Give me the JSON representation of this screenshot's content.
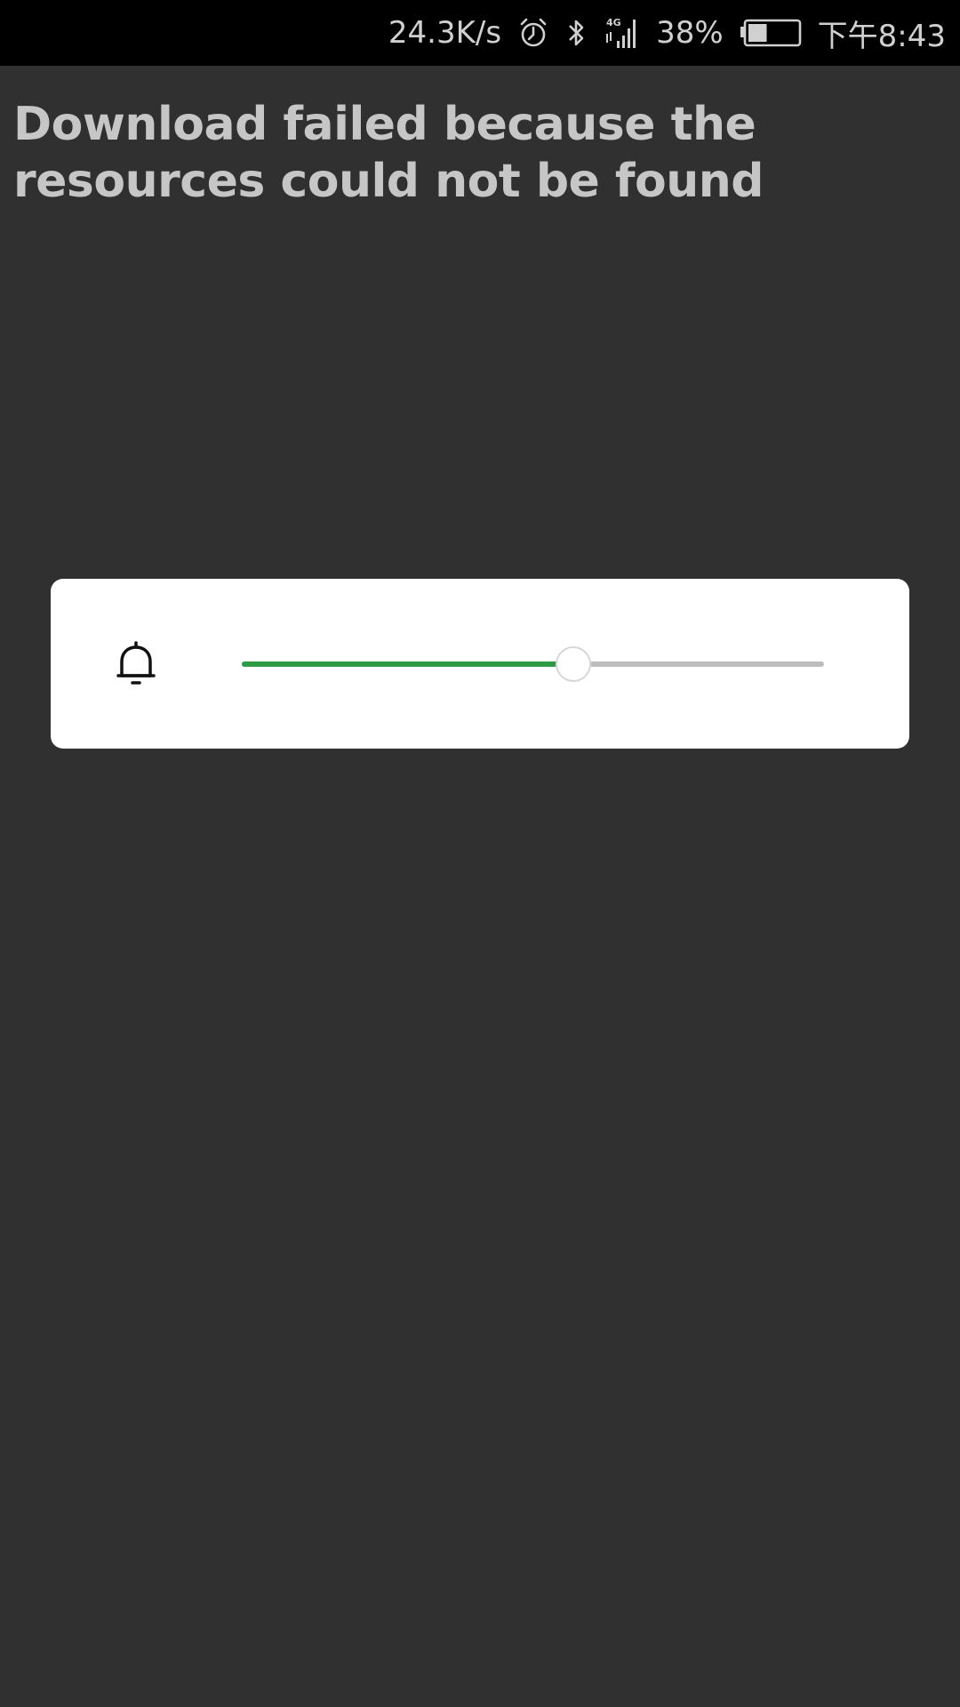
{
  "status_bar": {
    "network_speed": "24.3K/s",
    "alarm_icon": "alarm-icon",
    "bluetooth_icon": "bluetooth-icon",
    "signal_icon": "signal-4g-icon",
    "signal_label": "4G",
    "battery_percent": "38%",
    "battery_level": 0.38,
    "time": "下午8:43"
  },
  "message": {
    "text": "Download failed because the resources could not be found"
  },
  "volume_panel": {
    "icon": "bell-icon",
    "level": 0.57,
    "colors": {
      "fill": "#2e9b47",
      "track": "#bdbdbd"
    }
  }
}
